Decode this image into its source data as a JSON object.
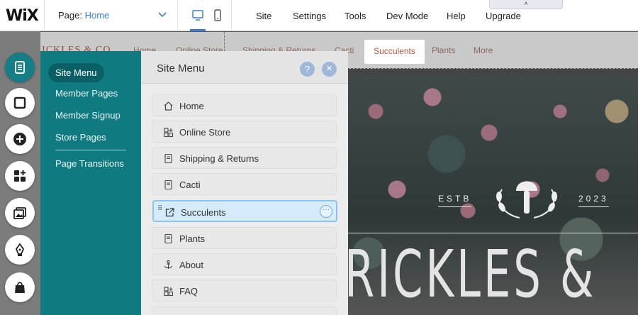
{
  "topbar": {
    "logo": "WiX",
    "page_label": "Page:",
    "page_value": "Home",
    "menu": [
      "Site",
      "Settings",
      "Tools",
      "Dev Mode",
      "Help",
      "Upgrade"
    ],
    "collapse_glyph": "˄"
  },
  "site": {
    "brand": "PRICKLES & CO",
    "nav": [
      "Home",
      "Online Store",
      "Shipping & Returns",
      "Cacti",
      "Succulents",
      "Plants",
      "More"
    ],
    "hero": {
      "estb": "ESTB",
      "year": "2023",
      "title": "RICKLES &"
    }
  },
  "toolbar": {
    "tools": [
      "pages-icon",
      "background-icon",
      "add-icon",
      "add-apps-icon",
      "media-icon",
      "design-pen-icon",
      "store-bag-icon"
    ],
    "accent": "#147d86"
  },
  "subnav": {
    "items": [
      "Site Menu",
      "Member Pages",
      "Member Signup",
      "Store Pages",
      "Page Transitions"
    ],
    "active": "Site Menu"
  },
  "panel": {
    "title": "Site Menu",
    "help_glyph": "?",
    "close_glyph": "✕",
    "rows": [
      {
        "label": "Home",
        "icon": "home-icon"
      },
      {
        "label": "Online Store",
        "icon": "store-grid-icon"
      },
      {
        "label": "Shipping & Returns",
        "icon": "page-icon"
      },
      {
        "label": "Cacti",
        "icon": "page-icon"
      },
      {
        "label": "Succulents",
        "icon": "external-link-icon",
        "selected": true
      },
      {
        "label": "Plants",
        "icon": "page-icon"
      },
      {
        "label": "About",
        "icon": "anchor-icon"
      },
      {
        "label": "FAQ",
        "icon": "store-grid-icon"
      }
    ],
    "more_glyph": "···",
    "drag_glyph": "⠿"
  }
}
